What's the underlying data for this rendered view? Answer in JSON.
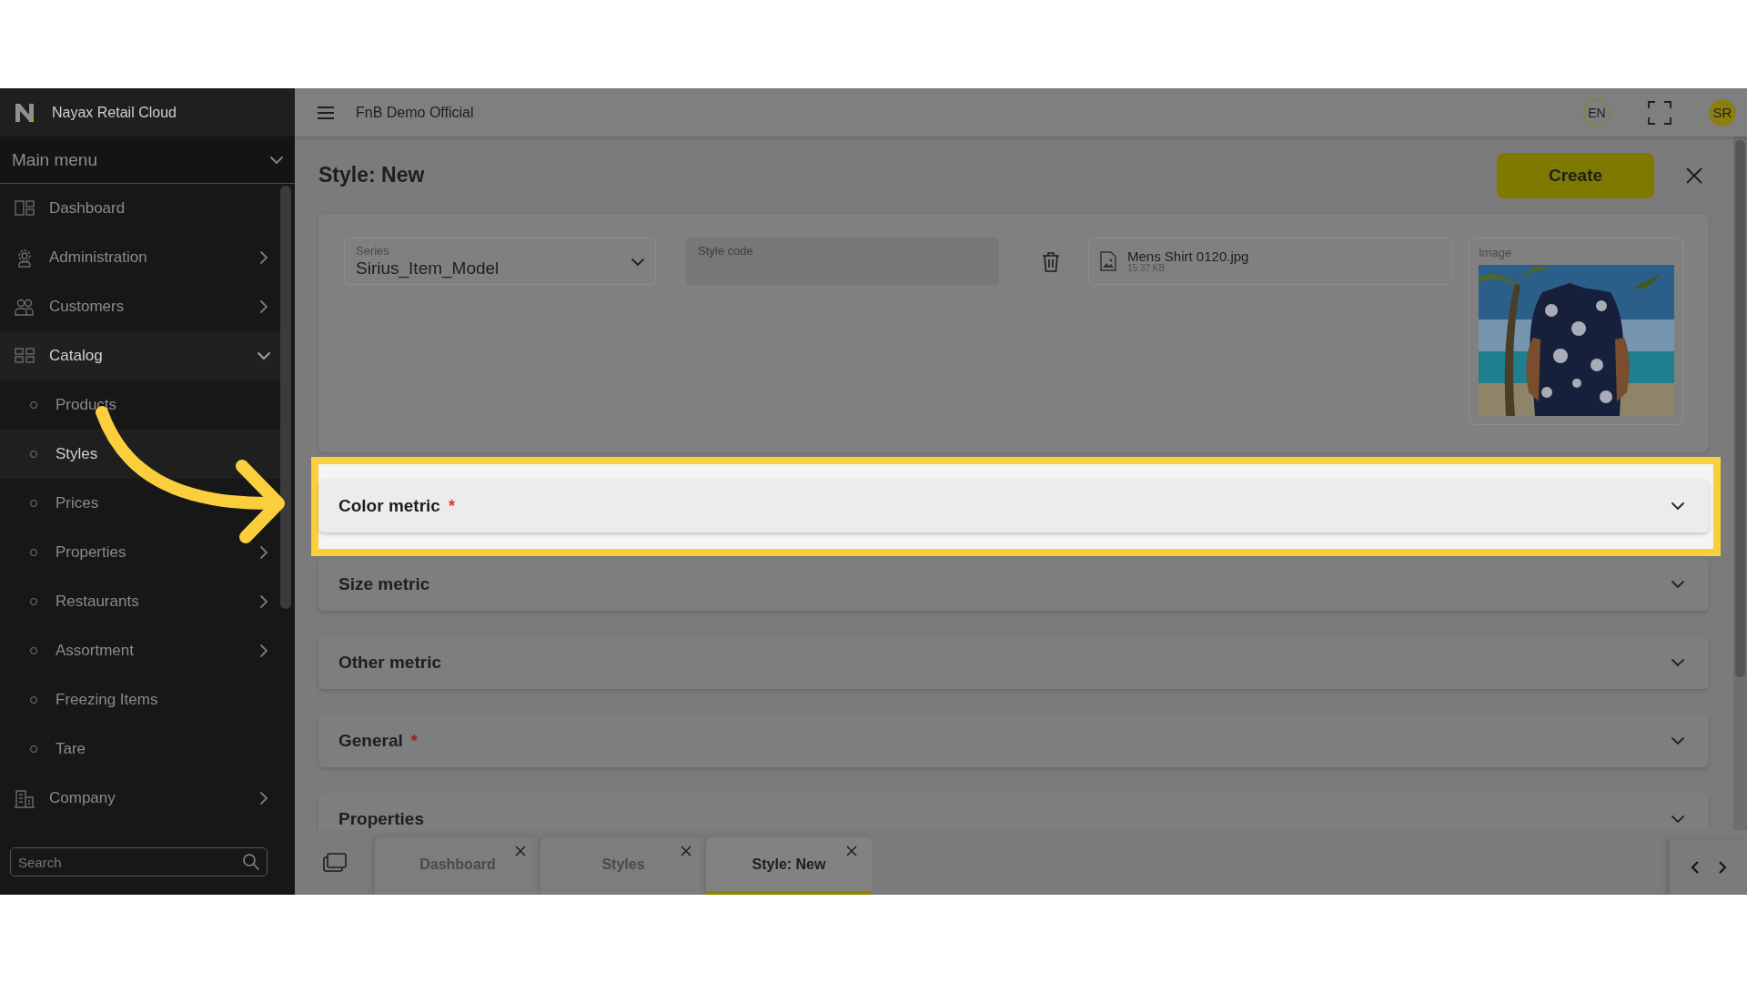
{
  "app": {
    "name": "Nayax Retail Cloud",
    "workspace": "FnB Demo Official",
    "language": "EN",
    "user_initials": "SR"
  },
  "sidebar": {
    "menu_title": "Main menu",
    "items": [
      {
        "label": "Dashboard",
        "submenu": false,
        "expanded": false
      },
      {
        "label": "Administration",
        "submenu": true,
        "expanded": false
      },
      {
        "label": "Customers",
        "submenu": true,
        "expanded": false
      },
      {
        "label": "Catalog",
        "submenu": true,
        "expanded": true,
        "children": [
          {
            "label": "Products",
            "submenu": false,
            "selected": false
          },
          {
            "label": "Styles",
            "submenu": false,
            "selected": true
          },
          {
            "label": "Prices",
            "selected": false
          },
          {
            "label": "Properties",
            "submenu": true,
            "selected": false
          },
          {
            "label": "Restaurants",
            "submenu": true,
            "selected": false
          },
          {
            "label": "Assortment",
            "submenu": true,
            "selected": false
          },
          {
            "label": "Freezing Items",
            "submenu": false,
            "selected": false
          },
          {
            "label": "Tare",
            "submenu": false,
            "selected": false
          }
        ]
      },
      {
        "label": "Company",
        "submenu": true,
        "expanded": false
      }
    ],
    "search": {
      "placeholder": "Search"
    }
  },
  "page": {
    "title": "Style: New",
    "create_button": "Create",
    "series": {
      "label": "Series",
      "value": "Sirius_Item_Model"
    },
    "style_code": {
      "label": "Style code"
    },
    "file": {
      "name": "Mens Shirt 0120.jpg",
      "size": "15.37 KB"
    },
    "image": {
      "label": "Image",
      "kind": "picture"
    },
    "required_marker": "*",
    "sections": [
      {
        "title": "Color metric",
        "required": true,
        "highlighted": true
      },
      {
        "title": "Size metric",
        "required": false,
        "highlighted": false
      },
      {
        "title": "Other metric",
        "required": false,
        "highlighted": false
      },
      {
        "title": "General",
        "required": true,
        "highlighted": false
      },
      {
        "title": "Properties",
        "required": false,
        "highlighted": false
      }
    ]
  },
  "tabs": [
    {
      "label": "Dashboard",
      "selected": false
    },
    {
      "label": "Styles",
      "selected": false
    },
    {
      "label": "Style: New",
      "selected": true
    }
  ]
}
